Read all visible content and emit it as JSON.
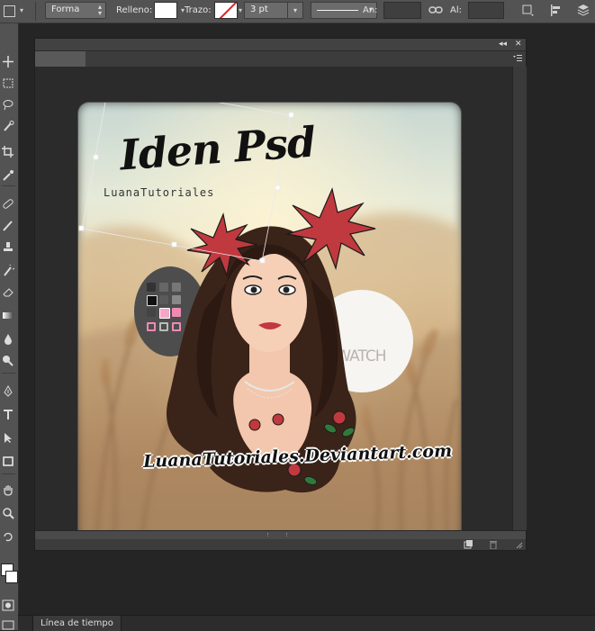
{
  "options_bar": {
    "mode_label": "Forma",
    "fill_label": "Relleno:",
    "stroke_label": "Trazo:",
    "stroke_width": "3 pt",
    "width_label": "An:",
    "height_label": "Al:",
    "fill_color": "#ffffff"
  },
  "artwork": {
    "logo_text": "Iden Psd",
    "logo_subtext": "LuanaTutoriales",
    "watch_text": "+WATCH",
    "signature_text": "LuanaTutoriales.Deviantart.com"
  },
  "bottom_panel": {
    "timeline_tab": "Línea de tiempo"
  },
  "colors": {
    "ui_panel": "#535353",
    "ui_dark": "#252525",
    "stroke_none_red": "#e02020",
    "flower_red": "#c0393f"
  }
}
